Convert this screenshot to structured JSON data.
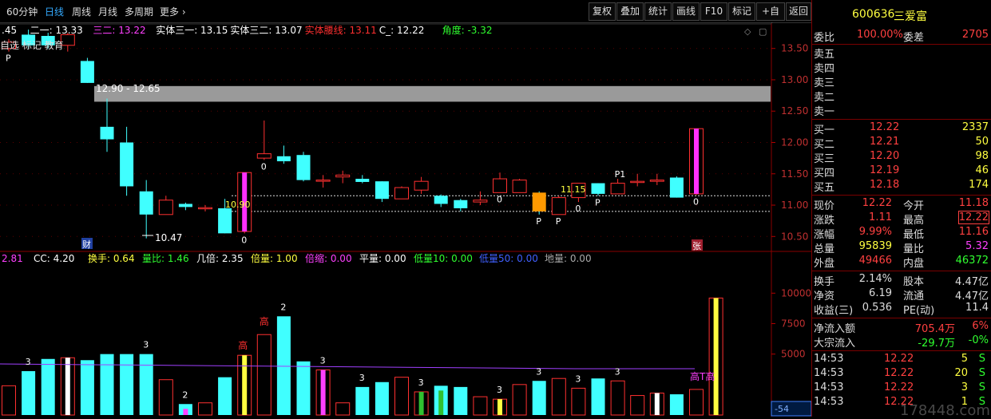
{
  "toolbar": {
    "periods": [
      "60分钟",
      "日线",
      "周线",
      "月线",
      "多周期",
      "更多"
    ],
    "active_period": "日线",
    "buttons": [
      "复权",
      "叠加",
      "统计",
      "画线",
      "F10",
      "标记",
      "+自选",
      "返回"
    ]
  },
  "stock": {
    "code": "600636",
    "name": "三爱富"
  },
  "ma_legend": [
    {
      "label": ".45",
      "color": "#ffffff"
    },
    {
      "label": "二一: 13.33",
      "color": "#ffffff"
    },
    {
      "label": "三二: 13.22",
      "color": "#ff40ff"
    },
    {
      "label": "实体三一: 13.15",
      "color": "#ffffff"
    },
    {
      "label": "实体三二: 13.07",
      "color": "#ffffff"
    },
    {
      "label": "实体腰线: 13.11",
      "color": "#ff3030"
    },
    {
      "label": "C_: 12.22",
      "color": "#ffffff"
    },
    {
      "label": "角度: -3.32",
      "color": "#30ff30"
    }
  ],
  "chart_overlay_text": {
    "top_left": "自选 标记 教育",
    "band_label": "12.90 - 12.65",
    "low_label": "10.47",
    "level_1090": "10.90",
    "level_1115": "11.15",
    "cai": "财",
    "zhang": "张"
  },
  "vol_legend": [
    {
      "label": "2.81",
      "color": "#ff40ff"
    },
    {
      "label": "CC: 4.20",
      "color": "#ffffff"
    },
    {
      "label": "换手: 0.64",
      "color": "#ffff40"
    },
    {
      "label": "量比: 1.46",
      "color": "#30ff30"
    },
    {
      "label": "几倍: 2.35",
      "color": "#ffffff"
    },
    {
      "label": "倍量: 1.00",
      "color": "#ffff40"
    },
    {
      "label": "倍缩: 0.00",
      "color": "#ff40ff"
    },
    {
      "label": "平量: 0.00",
      "color": "#ffffff"
    },
    {
      "label": "低量10: 0.00",
      "color": "#30ff30"
    },
    {
      "label": "低量50: 0.00",
      "color": "#4060ff"
    },
    {
      "label": "地量: 0.00",
      "color": "#aaaaaa"
    }
  ],
  "volume_markers": {
    "high": "高",
    "high_top": "高T高"
  },
  "corner_value": "-54",
  "chart_data": {
    "type": "candlestick",
    "price_axis": {
      "ticks": [
        10.5,
        11.0,
        11.5,
        12.0,
        12.5,
        13.0,
        13.5
      ],
      "labels": [
        "10.50",
        "11.00",
        "11.50",
        "12.00",
        "12.50",
        "13.00",
        "13.50"
      ],
      "range": [
        10.3,
        13.7
      ]
    },
    "volume_axis": {
      "ticks": [
        5000,
        7500,
        10000
      ],
      "labels": [
        "5000",
        "7500",
        "10000"
      ],
      "range": [
        0,
        11200
      ]
    },
    "band": [
      12.65,
      12.9
    ],
    "dashed_levels": [
      11.15,
      10.9
    ],
    "candles": [
      {
        "o": 13.5,
        "h": 13.65,
        "l": 13.45,
        "c": 13.6
      },
      {
        "o": 13.72,
        "h": 13.8,
        "l": 13.5,
        "c": 13.55
      },
      {
        "o": 13.7,
        "h": 13.75,
        "l": 13.5,
        "c": 13.55
      },
      {
        "o": 13.55,
        "h": 13.75,
        "l": 13.45,
        "c": 13.72
      },
      {
        "o": 13.3,
        "h": 13.35,
        "l": 12.95,
        "c": 12.95
      },
      {
        "o": 12.25,
        "h": 12.7,
        "l": 11.85,
        "c": 12.05
      },
      {
        "o": 12.0,
        "h": 12.25,
        "l": 11.15,
        "c": 11.3
      },
      {
        "o": 11.22,
        "h": 11.4,
        "l": 10.47,
        "c": 10.85
      },
      {
        "o": 10.85,
        "h": 11.15,
        "l": 10.85,
        "c": 11.08
      },
      {
        "o": 11.02,
        "h": 11.04,
        "l": 10.92,
        "c": 10.97
      },
      {
        "o": 10.96,
        "h": 11.0,
        "l": 10.9,
        "c": 10.96
      },
      {
        "o": 10.95,
        "h": 11.1,
        "l": 10.55,
        "c": 10.55
      },
      {
        "o": 10.58,
        "h": 11.52,
        "l": 10.55,
        "c": 11.52
      },
      {
        "o": 11.75,
        "h": 12.35,
        "l": 11.72,
        "c": 11.82
      },
      {
        "o": 11.78,
        "h": 11.95,
        "l": 11.66,
        "c": 11.7
      },
      {
        "o": 11.8,
        "h": 11.85,
        "l": 11.38,
        "c": 11.4
      },
      {
        "o": 11.4,
        "h": 11.48,
        "l": 11.28,
        "c": 11.4
      },
      {
        "o": 11.45,
        "h": 11.55,
        "l": 11.35,
        "c": 11.48
      },
      {
        "o": 11.42,
        "h": 11.48,
        "l": 11.35,
        "c": 11.37
      },
      {
        "o": 11.38,
        "h": 11.38,
        "l": 11.05,
        "c": 11.1
      },
      {
        "o": 11.1,
        "h": 11.3,
        "l": 11.1,
        "c": 11.28
      },
      {
        "o": 11.24,
        "h": 11.45,
        "l": 11.18,
        "c": 11.38
      },
      {
        "o": 11.15,
        "h": 11.17,
        "l": 10.97,
        "c": 11.02
      },
      {
        "o": 11.08,
        "h": 11.1,
        "l": 10.9,
        "c": 10.95
      },
      {
        "o": 11.05,
        "h": 11.22,
        "l": 11.0,
        "c": 11.08
      },
      {
        "o": 11.2,
        "h": 11.52,
        "l": 11.2,
        "c": 11.42
      },
      {
        "o": 11.2,
        "h": 11.42,
        "l": 11.2,
        "c": 11.4
      },
      {
        "o": 11.2,
        "h": 11.22,
        "l": 10.85,
        "c": 10.9
      },
      {
        "o": 10.85,
        "h": 11.15,
        "l": 10.85,
        "c": 11.12
      },
      {
        "o": 11.12,
        "h": 11.35,
        "l": 11.05,
        "c": 11.35
      },
      {
        "o": 11.35,
        "h": 11.35,
        "l": 11.15,
        "c": 11.18
      },
      {
        "o": 11.18,
        "h": 11.42,
        "l": 11.18,
        "c": 11.35
      },
      {
        "o": 11.38,
        "h": 11.5,
        "l": 11.3,
        "c": 11.38
      },
      {
        "o": 11.38,
        "h": 11.5,
        "l": 11.32,
        "c": 11.4
      },
      {
        "o": 11.44,
        "h": 11.46,
        "l": 11.12,
        "c": 11.12
      },
      {
        "o": 11.18,
        "h": 12.22,
        "l": 11.16,
        "c": 12.22
      }
    ],
    "pink_candles": [
      12,
      35
    ],
    "orange_candles": [
      27
    ],
    "volumes": [
      2400,
      3600,
      4600,
      4700,
      4500,
      5000,
      5000,
      5000,
      2900,
      900,
      1000,
      3100,
      4900,
      6600,
      8100,
      4400,
      3700,
      1000,
      2300,
      2700,
      3100,
      1900,
      2400,
      2300,
      1500,
      1300,
      2500,
      2800,
      3000,
      2200,
      3000,
      2800,
      1600,
      1800,
      1700,
      2100,
      9600
    ],
    "volume_colors": {
      "3": "#ffffff",
      "9": "#ff40ff",
      "16": "#ff40ff",
      "21": "#30c030",
      "22": "#30c030",
      "25": "#ffff40",
      "33": "#ffffff",
      "36": "#ffff40",
      "12": "#ffff40"
    },
    "volume_numbers": {
      "1": "3",
      "7": "3",
      "9": "2",
      "14": "2",
      "16": "3",
      "18": "3",
      "21": "3",
      "25": "3",
      "27": "3",
      "29": "3",
      "31": "3"
    },
    "candle_markers": {
      "0": "P",
      "12": "0",
      "13": "0",
      "25": "0",
      "27": "P",
      "28": "P",
      "29": "0",
      "30": "P",
      "31": "P1",
      "35": "0"
    }
  },
  "quote": {
    "webi": {
      "label": "委比",
      "value": "100.00%",
      "label2": "委差",
      "value2": "2705"
    },
    "asks": [
      {
        "label": "卖五",
        "price": "",
        "vol": ""
      },
      {
        "label": "卖四",
        "price": "",
        "vol": ""
      },
      {
        "label": "卖三",
        "price": "",
        "vol": ""
      },
      {
        "label": "卖二",
        "price": "",
        "vol": ""
      },
      {
        "label": "卖一",
        "price": "",
        "vol": ""
      }
    ],
    "bids": [
      {
        "label": "买一",
        "price": "12.22",
        "vol": "2337"
      },
      {
        "label": "买二",
        "price": "12.21",
        "vol": "50"
      },
      {
        "label": "买三",
        "price": "12.20",
        "vol": "98"
      },
      {
        "label": "买四",
        "price": "12.19",
        "vol": "46"
      },
      {
        "label": "买五",
        "price": "12.18",
        "vol": "174"
      }
    ],
    "stats": [
      {
        "l1": "现价",
        "v1": "12.22",
        "c1": "#ff4040",
        "l2": "今开",
        "v2": "11.18",
        "c2": "#ff4040"
      },
      {
        "l1": "涨跌",
        "v1": "1.11",
        "c1": "#ff4040",
        "l2": "最高",
        "v2": "12.22",
        "c2": "#ff4040"
      },
      {
        "l1": "涨幅",
        "v1": "9.99%",
        "c1": "#ff4040",
        "l2": "最低",
        "v2": "11.16",
        "c2": "#ff4040"
      },
      {
        "l1": "总量",
        "v1": "95839",
        "c1": "#ffff40",
        "l2": "量比",
        "v2": "5.32",
        "c2": "#ff40ff"
      },
      {
        "l1": "外盘",
        "v1": "49466",
        "c1": "#ff4040",
        "l2": "内盘",
        "v2": "46372",
        "c2": "#30ff30"
      }
    ],
    "fund": [
      {
        "l1": "换手",
        "v1": "2.14%",
        "l2": "股本",
        "v2": "4.47亿"
      },
      {
        "l1": "净资",
        "v1": "6.19",
        "l2": "流通",
        "v2": "4.47亿"
      },
      {
        "l1": "收益(三)",
        "v1": "0.536",
        "l2": "PE(动)",
        "v2": "11.4"
      }
    ],
    "flow": [
      {
        "label": "净流入额",
        "value": "705.4万",
        "pct": "6%",
        "color": "#ff4040"
      },
      {
        "label": "大宗流入",
        "value": "-29.7万",
        "pct": "-0%",
        "color": "#30ff30"
      }
    ],
    "ticks": [
      {
        "time": "14:53",
        "price": "12.22",
        "vol": "5",
        "side": "S"
      },
      {
        "time": "14:53",
        "price": "12.22",
        "vol": "20",
        "side": "S"
      },
      {
        "time": "14:53",
        "price": "12.22",
        "vol": "3",
        "side": "S"
      },
      {
        "time": "14:53",
        "price": "12.22",
        "vol": "1",
        "side": "S"
      }
    ]
  },
  "watermark": "178448.com"
}
